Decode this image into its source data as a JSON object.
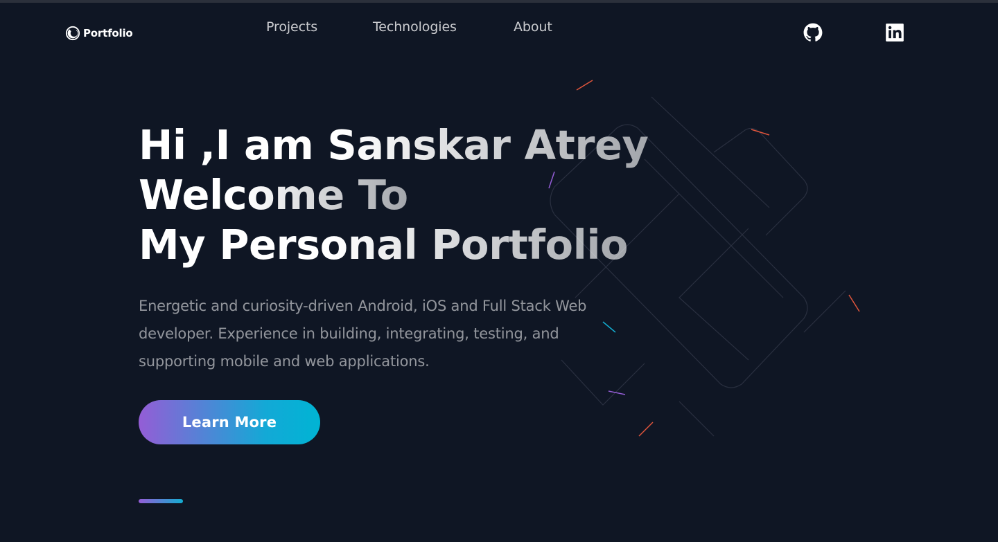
{
  "nav": {
    "logo_text": "Portfolio",
    "links": [
      {
        "label": "Projects"
      },
      {
        "label": "Technologies"
      },
      {
        "label": "About"
      }
    ],
    "social": [
      {
        "icon": "github-icon"
      },
      {
        "icon": "linkedin-icon"
      }
    ]
  },
  "hero": {
    "title_line1_a": "Hi ,I am ",
    "title_line1_b": "Sanskar Atrey",
    "title_line2": "Welcome To",
    "title_line3_a": "My Personal ",
    "title_line3_b": "Portfolio",
    "description": "Energetic and curiosity-driven Android, iOS and Full Stack Web developer. Experience in building, integrating, testing, and supporting mobile and web applications.",
    "cta_label": "Learn More"
  },
  "colors": {
    "background": "#0f1624",
    "gradient_start": "#945dd6",
    "gradient_end": "#00b4d4",
    "text": "#ffffff"
  }
}
